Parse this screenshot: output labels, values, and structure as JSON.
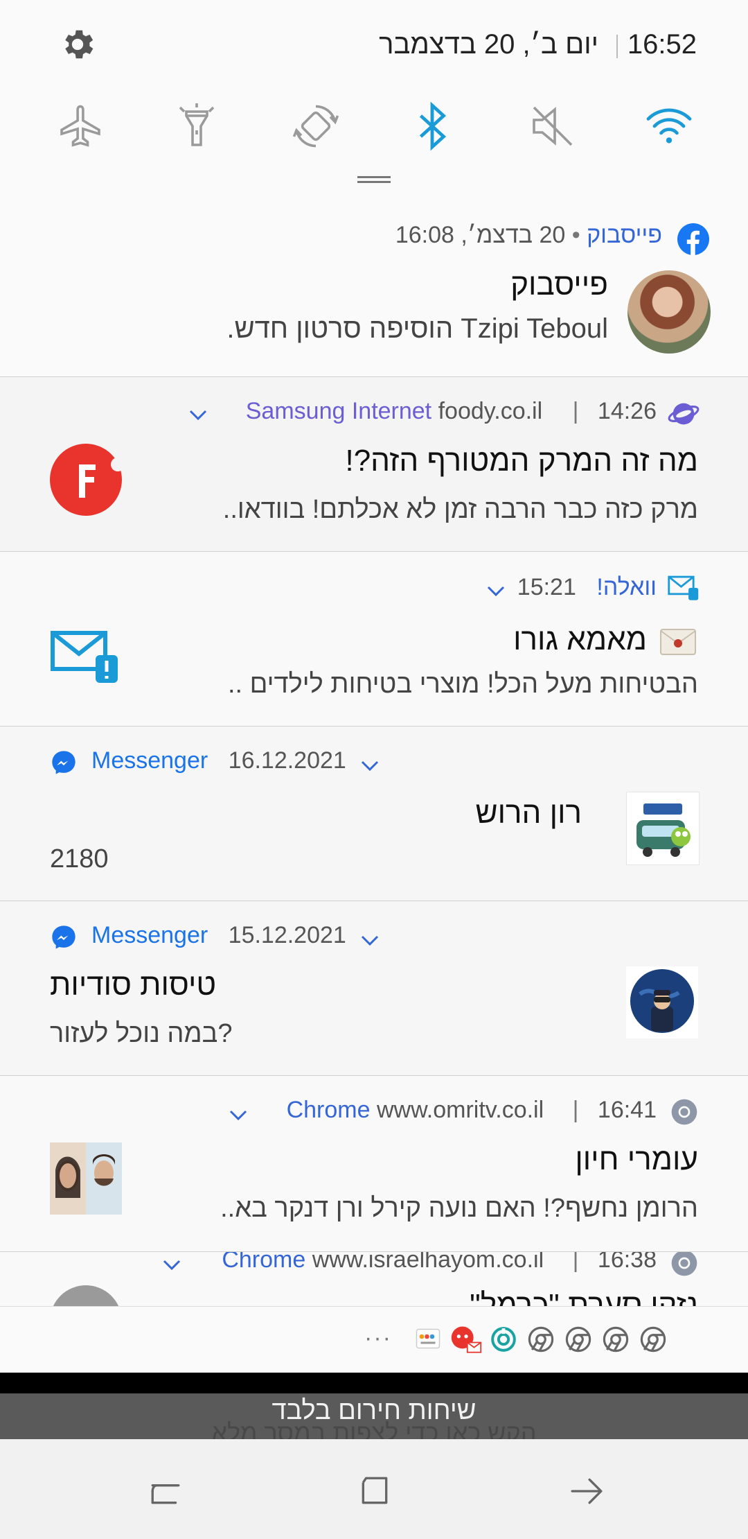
{
  "status": {
    "time": "16:52",
    "date": "יום ב׳, 20 בדצמבר"
  },
  "quick_settings": [
    {
      "icon": "wifi-icon",
      "state": "on"
    },
    {
      "icon": "sound-mute-icon",
      "state": "off"
    },
    {
      "icon": "bluetooth-icon",
      "state": "on"
    },
    {
      "icon": "auto-rotate-icon",
      "state": "off"
    },
    {
      "icon": "flashlight-icon",
      "state": "off"
    },
    {
      "icon": "airplane-mode-icon",
      "state": "off"
    }
  ],
  "colors": {
    "accent": "#1a9bd8",
    "link": "#3566d8",
    "facebook": "#1877f2",
    "messenger": "#1a73e8",
    "foody": "#e8342c"
  },
  "notifications": [
    {
      "id": "facebook",
      "app": "פייסבוק",
      "time": "20 בדצמ׳, 16:08",
      "title": "פייסבוק",
      "body": "Tzipi Teboul הוסיפה סרטון חדש."
    },
    {
      "id": "samsung",
      "app": "Samsung Internet",
      "site": "foody.co.il",
      "time": "14:26",
      "title": "מה זה המרק המטורף הזה?!",
      "body": "מרק כזה כבר הרבה זמן לא אכלתם! בוודאו.."
    },
    {
      "id": "walla",
      "app": "וואלה!",
      "time": "15:21",
      "title": "מאמא גורו",
      "body": "הבטיחות מעל הכל! מוצרי בטיחות לילדים .."
    },
    {
      "id": "messenger1",
      "app": "Messenger",
      "time": "16.12.2021",
      "title": "רון הרוש",
      "body": "2180"
    },
    {
      "id": "messenger2",
      "app": "Messenger",
      "time": "15.12.2021",
      "title": "טיסות סודיות",
      "body": "במה נוכל לעזור?"
    },
    {
      "id": "chrome1",
      "app": "Chrome",
      "site": "www.omritv.co.il",
      "time": "16:41",
      "title": "עומרי חיון",
      "body": "הרומן נחשף?! האם נועה קירל ורן דנקר בא.."
    },
    {
      "id": "chrome2",
      "app": "Chrome",
      "site": "www.israelhayom.co.il",
      "time": "16:38",
      "title": "נזקי סערת \"כרמל\""
    }
  ],
  "dock": {
    "more": "···",
    "icons": [
      "chrome-icon",
      "chrome-icon",
      "chrome-icon",
      "chrome-icon",
      "sync-icon",
      "mail-icon",
      "yala-icon"
    ]
  },
  "emergency": {
    "label": "שיחות חירום בלבד",
    "sub": "הקש כאן כדי לצפות במסך מלא"
  },
  "nav": [
    "back-button",
    "home-button",
    "recents-button"
  ]
}
